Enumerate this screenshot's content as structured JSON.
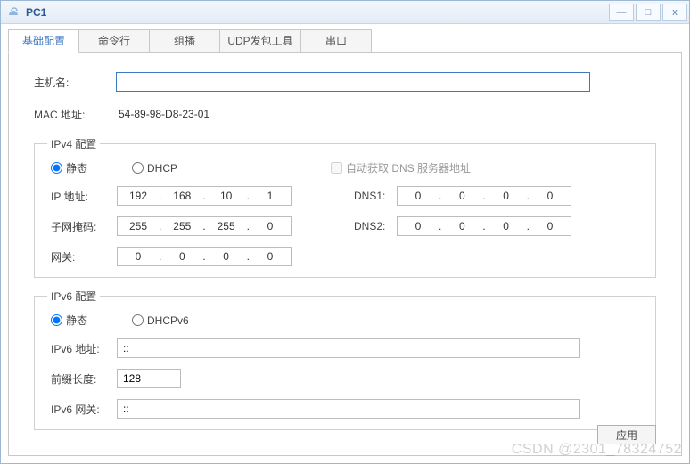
{
  "window": {
    "title": "PC1"
  },
  "tabs": [
    {
      "label": "基础配置"
    },
    {
      "label": "命令行"
    },
    {
      "label": "组播"
    },
    {
      "label": "UDP发包工具"
    },
    {
      "label": "串口"
    }
  ],
  "basic": {
    "hostname_label": "主机名:",
    "hostname_value": "",
    "mac_label": "MAC 地址:",
    "mac_value": "54-89-98-D8-23-01"
  },
  "ipv4": {
    "legend": "IPv4 配置",
    "radio_static": "静态",
    "radio_dhcp": "DHCP",
    "auto_dns_label": "自动获取 DNS 服务器地址",
    "ip_label": "IP 地址:",
    "ip": [
      "192",
      "168",
      "10",
      "1"
    ],
    "mask_label": "子网掩码:",
    "mask": [
      "255",
      "255",
      "255",
      "0"
    ],
    "gw_label": "网关:",
    "gw": [
      "0",
      "0",
      "0",
      "0"
    ],
    "dns1_label": "DNS1:",
    "dns1": [
      "0",
      "0",
      "0",
      "0"
    ],
    "dns2_label": "DNS2:",
    "dns2": [
      "0",
      "0",
      "0",
      "0"
    ]
  },
  "ipv6": {
    "legend": "IPv6 配置",
    "radio_static": "静态",
    "radio_dhcp": "DHCPv6",
    "addr_label": "IPv6 地址:",
    "addr_value": "::",
    "prefix_label": "前缀长度:",
    "prefix_value": "128",
    "gw_label": "IPv6 网关:",
    "gw_value": "::"
  },
  "buttons": {
    "apply": "应用"
  },
  "watermark": "CSDN @2301_78324752"
}
